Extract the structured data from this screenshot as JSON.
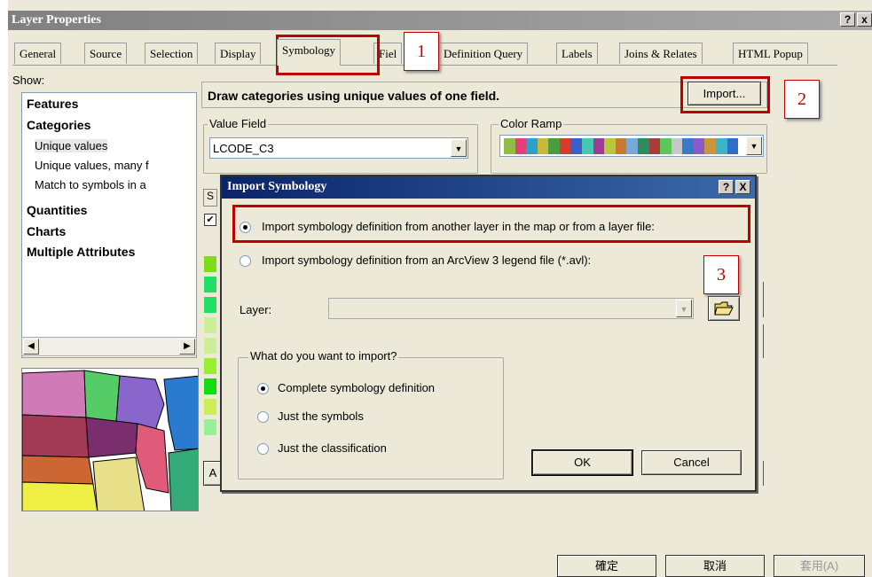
{
  "window": {
    "title": "Layer Properties",
    "help_glyph": "?",
    "close_glyph": "x"
  },
  "tabs": [
    {
      "label": "General"
    },
    {
      "label": "Source"
    },
    {
      "label": "Selection"
    },
    {
      "label": "Display"
    },
    {
      "label": "Symbology"
    },
    {
      "label": "Fiel"
    },
    {
      "label": "Definition Query"
    },
    {
      "label": "Labels"
    },
    {
      "label": "Joins & Relates"
    },
    {
      "label": "HTML Popup"
    }
  ],
  "callouts": [
    "1",
    "2",
    "3"
  ],
  "show": {
    "label": "Show:",
    "items": {
      "features": "Features",
      "categories": "Categories",
      "unique_values": "Unique values",
      "unique_values_many": "Unique values, many f",
      "match_symbols": "Match to symbols in a",
      "quantities": "Quantities",
      "charts": "Charts",
      "multiple_attributes": "Multiple Attributes"
    }
  },
  "main": {
    "description": "Draw categories using unique values of one field.",
    "import_label": "Import...",
    "value_field_label": "Value Field",
    "value_field_value": "LCODE_C3",
    "color_ramp_label": "Color Ramp",
    "ramp_colors": [
      "#8fbc44",
      "#e53e7a",
      "#2e9fc8",
      "#c8b83a",
      "#4a9c3c",
      "#d63c2e",
      "#3a5fc8",
      "#46c8b0",
      "#9c3c96",
      "#b8c83a",
      "#c87a2e",
      "#7aa8d8",
      "#2e8c5a",
      "#a83c3c",
      "#5ac85a",
      "#c8c8c8",
      "#3c78c8",
      "#8c5ac8",
      "#c8963c",
      "#3cb4c8",
      "#2e6ec8"
    ],
    "legend_colors": [
      "#7ddd1a",
      "#22dd66",
      "#22dd66",
      "#ccee99",
      "#ccee99",
      "#99ee33",
      "#11dd11",
      "#ccee55",
      "#99ee99"
    ],
    "partial_tab": "S",
    "partial_btn": "A"
  },
  "dialog": {
    "title": "Import Symbology",
    "help_glyph": "?",
    "close_glyph": "X",
    "option_layer": "Import symbology definition from another layer in the map or from a layer file:",
    "option_avl": "Import symbology definition from an ArcView 3 legend file (*.avl):",
    "layer_label": "Layer:",
    "layer_value": "",
    "group_label": "What do you want to import?",
    "choices": {
      "complete": "Complete symbology definition",
      "symbols": "Just the symbols",
      "classification": "Just the classification"
    },
    "ok_label": "OK",
    "cancel_label": "Cancel"
  },
  "footer": {
    "ok_label": "確定",
    "cancel_label": "取消",
    "apply_label": "套用(A)"
  }
}
